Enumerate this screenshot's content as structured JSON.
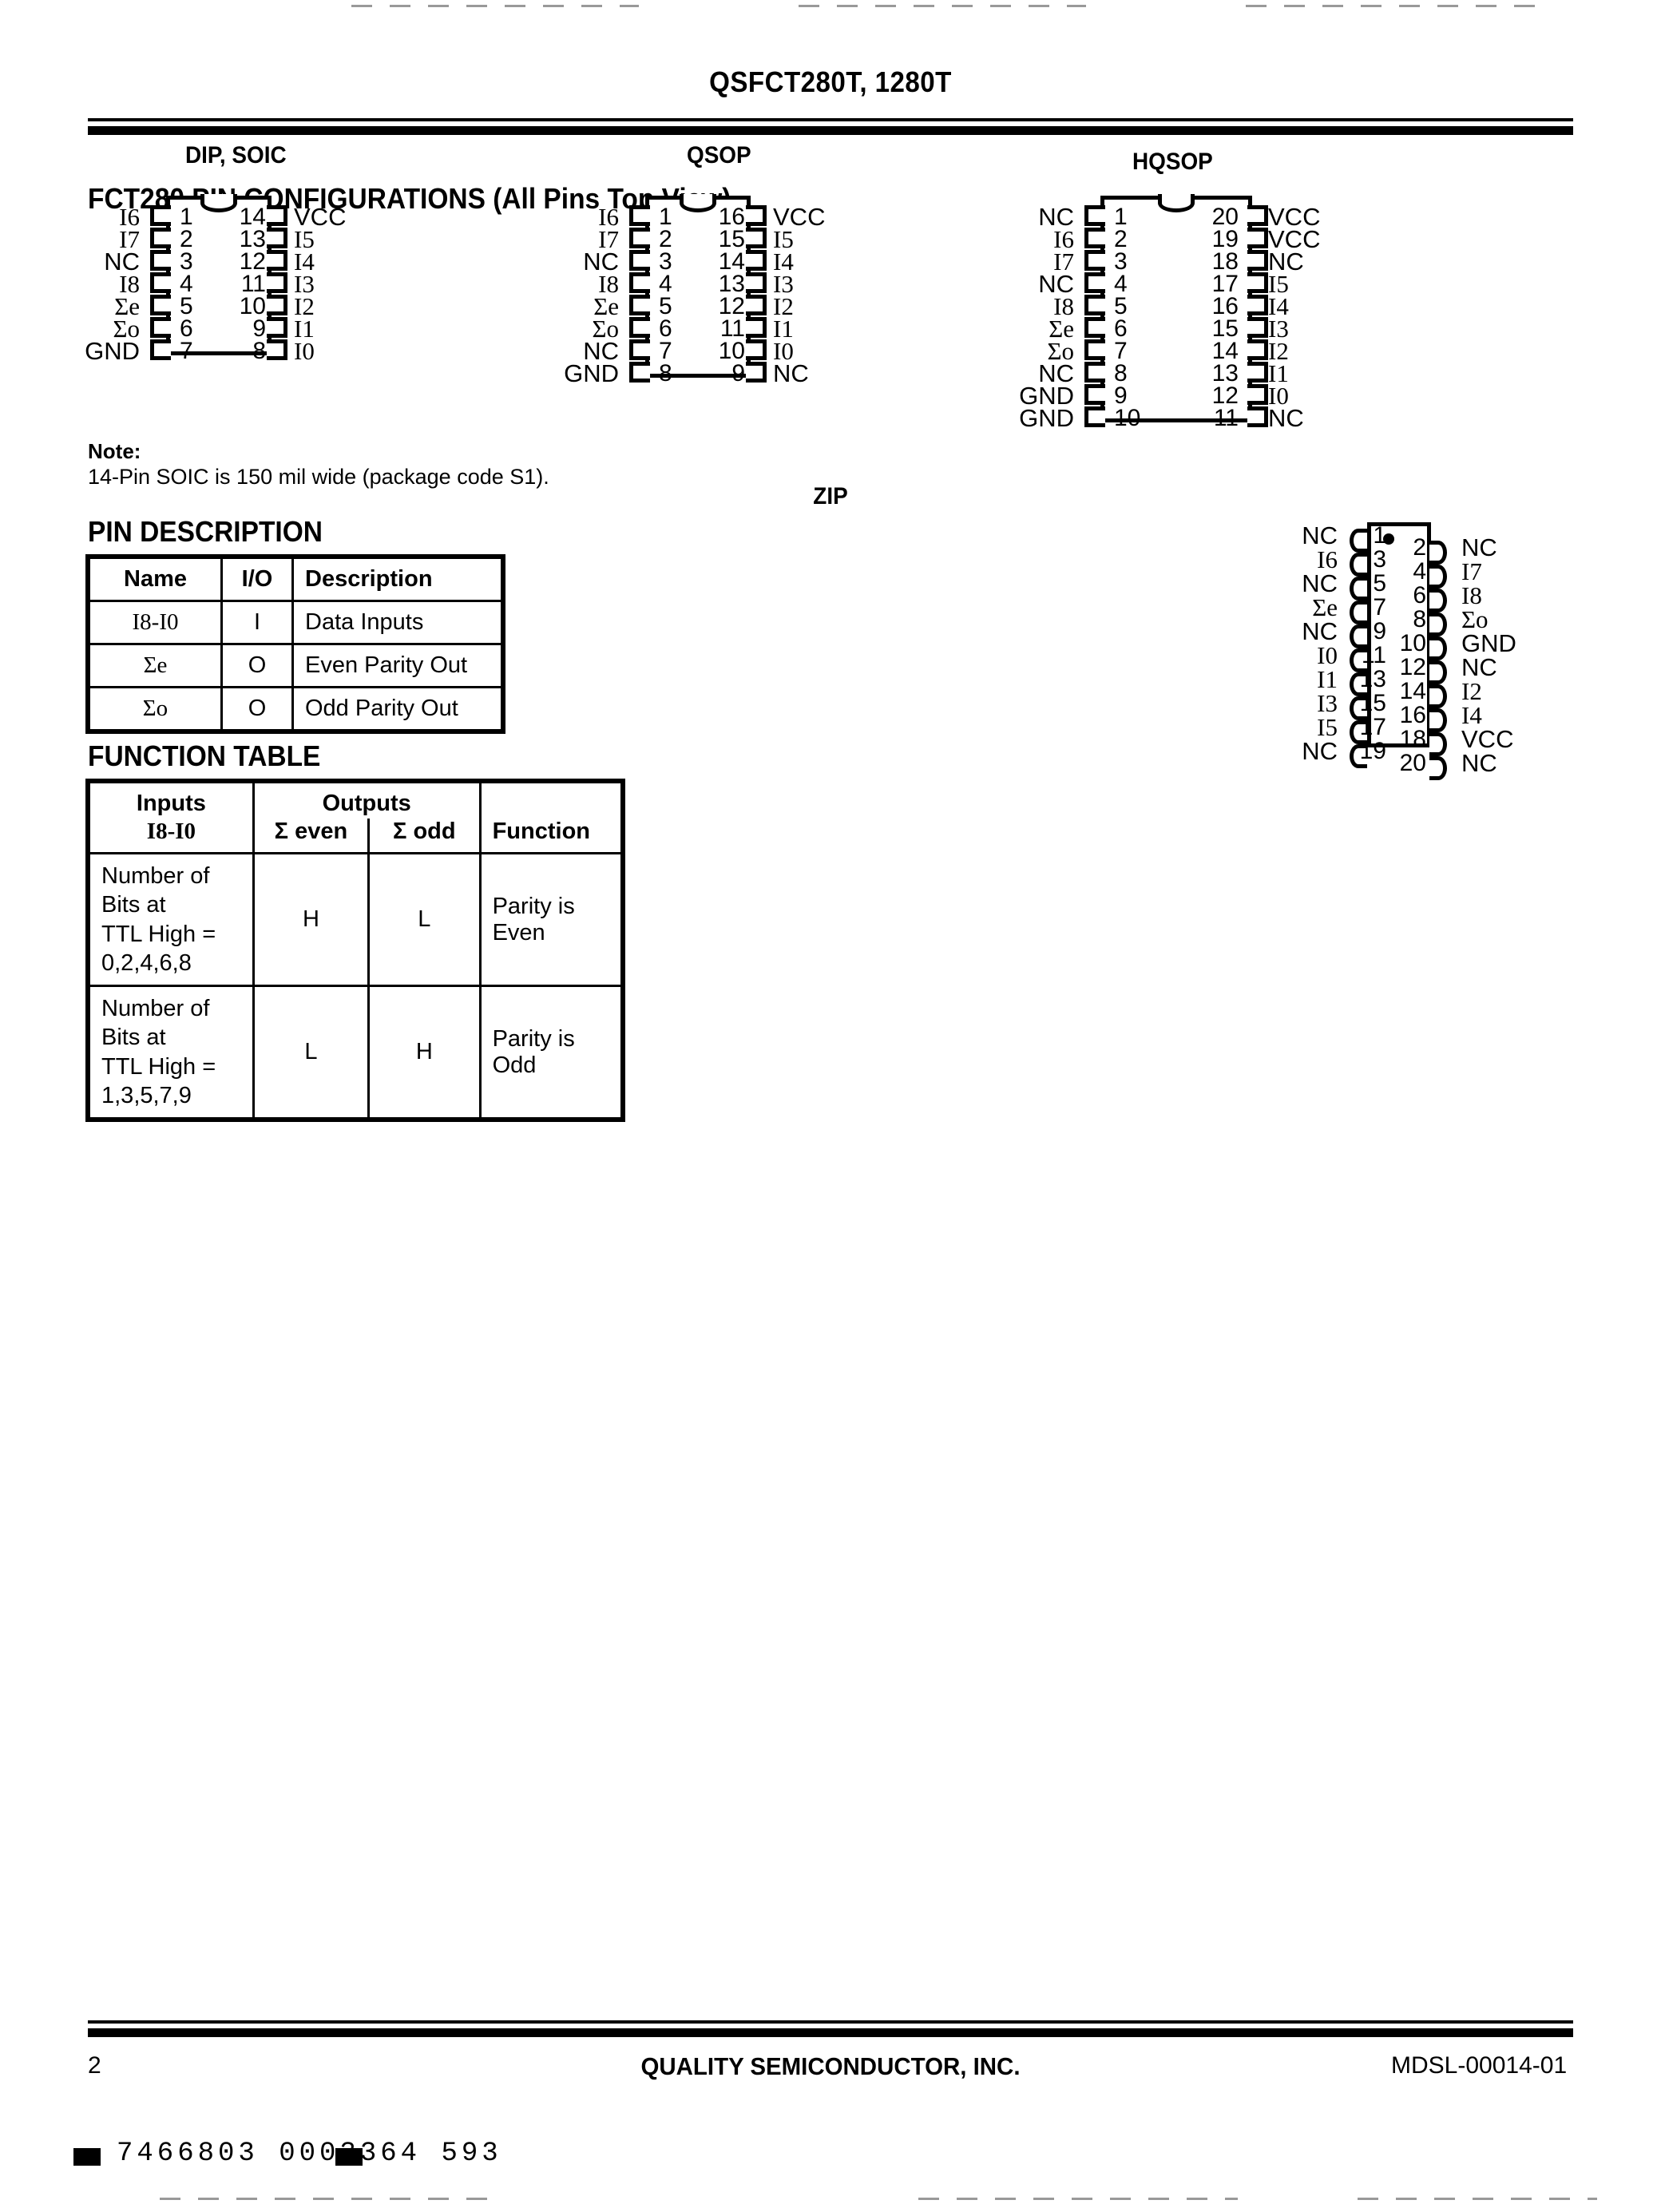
{
  "header": {
    "doc_title": "QSFCT280T, 1280T"
  },
  "sections": {
    "pin_config_heading": "FCT280 PIN CONFIGURATIONS (All Pins Top View)",
    "pin_description_heading": "PIN DESCRIPTION",
    "function_table_heading": "FUNCTION TABLE"
  },
  "packages": [
    {
      "name": "dip_soic",
      "title": "DIP, SOIC",
      "pin_count": 14,
      "left": [
        {
          "num": "1",
          "label": "I6"
        },
        {
          "num": "2",
          "label": "I7"
        },
        {
          "num": "3",
          "label": "NC"
        },
        {
          "num": "4",
          "label": "I8"
        },
        {
          "num": "5",
          "label": "Σe"
        },
        {
          "num": "6",
          "label": "Σo"
        },
        {
          "num": "7",
          "label": "GND"
        }
      ],
      "right": [
        {
          "num": "14",
          "label": "VCC"
        },
        {
          "num": "13",
          "label": "I5"
        },
        {
          "num": "12",
          "label": "I4"
        },
        {
          "num": "11",
          "label": "I3"
        },
        {
          "num": "10",
          "label": "I2"
        },
        {
          "num": "9",
          "label": "I1"
        },
        {
          "num": "8",
          "label": "I0"
        }
      ]
    },
    {
      "name": "qsop",
      "title": "QSOP",
      "pin_count": 16,
      "left": [
        {
          "num": "1",
          "label": "I6"
        },
        {
          "num": "2",
          "label": "I7"
        },
        {
          "num": "3",
          "label": "NC"
        },
        {
          "num": "4",
          "label": "I8"
        },
        {
          "num": "5",
          "label": "Σe"
        },
        {
          "num": "6",
          "label": "Σo"
        },
        {
          "num": "7",
          "label": "NC"
        },
        {
          "num": "8",
          "label": "GND"
        }
      ],
      "right": [
        {
          "num": "16",
          "label": "VCC"
        },
        {
          "num": "15",
          "label": "I5"
        },
        {
          "num": "14",
          "label": "I4"
        },
        {
          "num": "13",
          "label": "I3"
        },
        {
          "num": "12",
          "label": "I2"
        },
        {
          "num": "11",
          "label": "I1"
        },
        {
          "num": "10",
          "label": "I0"
        },
        {
          "num": "9",
          "label": "NC"
        }
      ]
    },
    {
      "name": "hqsop",
      "title": "HQSOP",
      "pin_count": 20,
      "left": [
        {
          "num": "1",
          "label": "NC"
        },
        {
          "num": "2",
          "label": "I6"
        },
        {
          "num": "3",
          "label": "I7"
        },
        {
          "num": "4",
          "label": "NC"
        },
        {
          "num": "5",
          "label": "I8"
        },
        {
          "num": "6",
          "label": "Σe"
        },
        {
          "num": "7",
          "label": "Σo"
        },
        {
          "num": "8",
          "label": "NC"
        },
        {
          "num": "9",
          "label": "GND"
        },
        {
          "num": "10",
          "label": "GND"
        }
      ],
      "right": [
        {
          "num": "20",
          "label": "VCC"
        },
        {
          "num": "19",
          "label": "VCC"
        },
        {
          "num": "18",
          "label": "NC"
        },
        {
          "num": "17",
          "label": "I5"
        },
        {
          "num": "16",
          "label": "I4"
        },
        {
          "num": "15",
          "label": "I3"
        },
        {
          "num": "14",
          "label": "I2"
        },
        {
          "num": "13",
          "label": "I1"
        },
        {
          "num": "12",
          "label": "I0"
        },
        {
          "num": "11",
          "label": "NC"
        }
      ]
    }
  ],
  "zip": {
    "title": "ZIP",
    "pin_count": 20,
    "left": [
      {
        "num": "1",
        "label": "NC"
      },
      {
        "num": "3",
        "label": "I6"
      },
      {
        "num": "5",
        "label": "NC"
      },
      {
        "num": "7",
        "label": "Σe"
      },
      {
        "num": "9",
        "label": "NC"
      },
      {
        "num": "11",
        "label": "I0"
      },
      {
        "num": "13",
        "label": "I1"
      },
      {
        "num": "15",
        "label": "I3"
      },
      {
        "num": "17",
        "label": "I5"
      },
      {
        "num": "19",
        "label": "NC"
      }
    ],
    "right": [
      {
        "num": "2",
        "label": "NC"
      },
      {
        "num": "4",
        "label": "I7"
      },
      {
        "num": "6",
        "label": "I8"
      },
      {
        "num": "8",
        "label": "Σo"
      },
      {
        "num": "10",
        "label": "GND"
      },
      {
        "num": "12",
        "label": "NC"
      },
      {
        "num": "14",
        "label": "I2"
      },
      {
        "num": "16",
        "label": "I4"
      },
      {
        "num": "18",
        "label": "VCC"
      },
      {
        "num": "20",
        "label": "NC"
      }
    ]
  },
  "note": {
    "label": "Note:",
    "text": "14-Pin SOIC is 150 mil wide (package code S1)."
  },
  "pin_description_table": {
    "headers": [
      "Name",
      "I/O",
      "Description"
    ],
    "rows": [
      {
        "name": "I8-I0",
        "io": "I",
        "description": "Data Inputs"
      },
      {
        "name": "Σe",
        "io": "O",
        "description": "Even Parity Out"
      },
      {
        "name": "Σo",
        "io": "O",
        "description": "Odd Parity Out"
      }
    ]
  },
  "function_table": {
    "group_headers": [
      "Inputs",
      "Outputs"
    ],
    "sub_headers": [
      "I8-I0",
      "Σ even",
      "Σ odd",
      "Function"
    ],
    "rows": [
      {
        "inputs_line1": "Number of Bits at",
        "inputs_line2": "TTL High = 0,2,4,6,8",
        "sigma_even": "H",
        "sigma_odd": "L",
        "function": "Parity is Even"
      },
      {
        "inputs_line1": "Number of Bits at",
        "inputs_line2": "TTL High = 1,3,5,7,9",
        "sigma_even": "L",
        "sigma_odd": "H",
        "function": "Parity is Odd"
      }
    ]
  },
  "footer": {
    "page_number": "2",
    "company": "QUALITY SEMICONDUCTOR, INC.",
    "doc_code": "MDSL-00014-01",
    "barcode_text": "7466803 0003364 593"
  }
}
